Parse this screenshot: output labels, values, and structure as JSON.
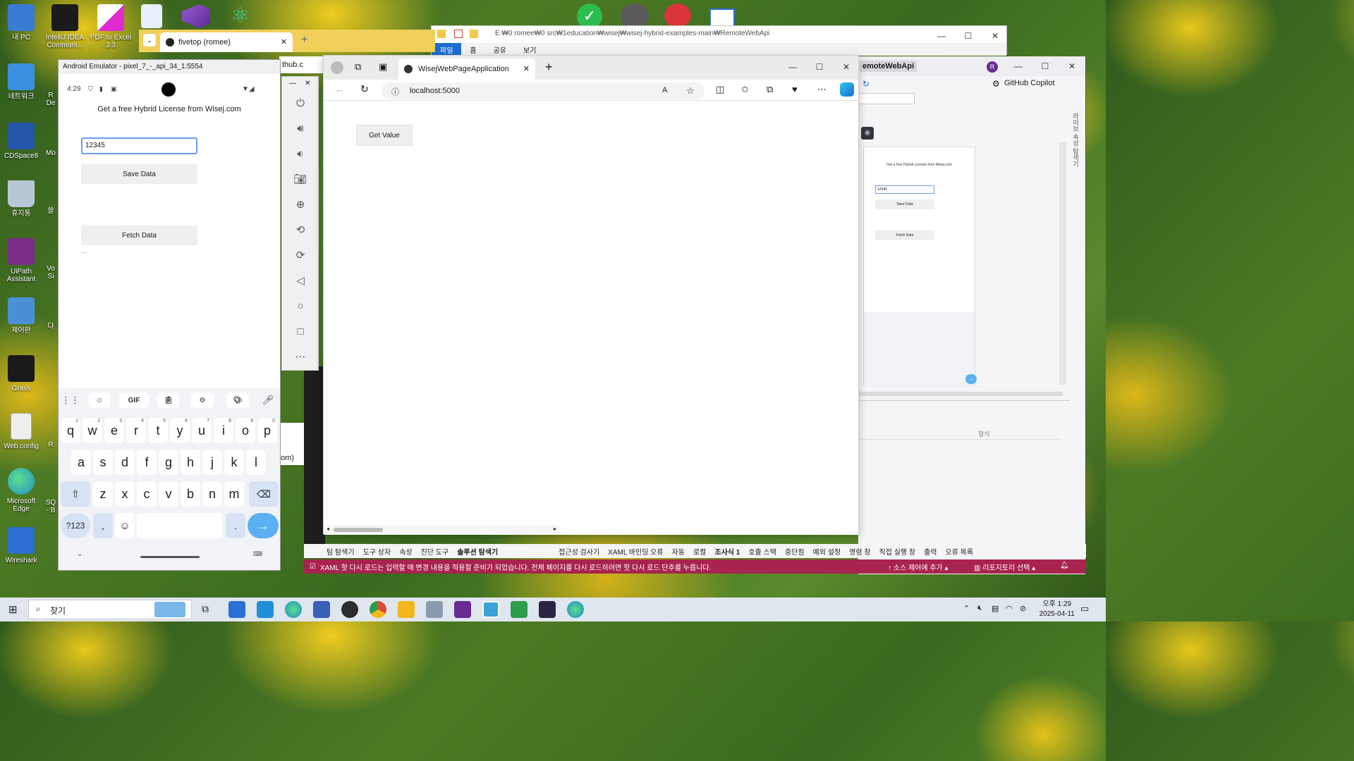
{
  "desktop": {
    "icons": [
      {
        "label": "내 PC",
        "color": "#3a7bd5"
      },
      {
        "label": "IntelliJ IDEA Communi...",
        "color": "#1b1b1b"
      },
      {
        "label": "PDF to Excel 3.3",
        "color": "#f2f2f2"
      },
      {
        "label": "네트워크",
        "color": "#3a8fe0"
      },
      {
        "label": "CDSpace8",
        "color": "#2457a8"
      },
      {
        "label": "휴지통",
        "color": "#b7c7d6"
      },
      {
        "label": "UiPath Assistant",
        "color": "#7b2d87"
      },
      {
        "label": "제어판",
        "color": "#4a90d9"
      },
      {
        "label": "Grass",
        "color": "#1a1a1a"
      },
      {
        "label": "Web.config",
        "color": "#eeeeee"
      },
      {
        "label": "Microsoft Edge",
        "color": "#1e90c8"
      },
      {
        "label": "Wireshark",
        "color": "#2d6fd1"
      }
    ],
    "partial_labels": [
      "R De",
      "Mo",
      "쓸",
      "Vo Si",
      "다",
      "R",
      "SQ - B"
    ]
  },
  "explorer": {
    "path": "E:₩0 romee₩0 src₩1education₩wisej₩wisej-hybrid-examples-main₩RemoteWebApi",
    "tabs": [
      "파일",
      "홈",
      "공유",
      "보기"
    ]
  },
  "chrome": {
    "tab_title": "fivetop (romee)",
    "behind_tab_text": "thub.c"
  },
  "android_emulator": {
    "window_title": "Android Emulator - pixel_7_-_api_34_1:5554",
    "time": "4:29",
    "headline": "Get a free Hybrid License from Wisej.com",
    "input_value": "12345",
    "save_button": "Save Data",
    "fetch_button": "Fetch Data",
    "result_text": "...",
    "keyboard": {
      "toolbar_gif": "GIF",
      "row1": [
        "q",
        "w",
        "e",
        "r",
        "t",
        "y",
        "u",
        "i",
        "o",
        "p"
      ],
      "row1_hints": [
        "1",
        "2",
        "3",
        "4",
        "5",
        "6",
        "7",
        "8",
        "9",
        "0"
      ],
      "row2": [
        "a",
        "s",
        "d",
        "f",
        "g",
        "h",
        "j",
        "k",
        "l"
      ],
      "row3": [
        "z",
        "x",
        "c",
        "v",
        "b",
        "n",
        "m"
      ],
      "symbols_key": "?123",
      "comma_key": ",",
      "period_key": "."
    }
  },
  "edge": {
    "tab_title": "WisejWebPageApplication",
    "url": "localhost:5000",
    "page_button": "Get Value"
  },
  "visual_studio": {
    "title_fragment": "emoteWebApi",
    "avatar_letter": "R",
    "copilot_label": "GitHub Copilot",
    "preview": {
      "headline": "Get a free Hybrid License from Wisej.com",
      "input_value": "12345",
      "save_button": "Save Data",
      "fetch_button": "Fetch Data"
    },
    "output_column_header": "형식",
    "side_tab": "라이브 속성 탐색기",
    "bottom_tabs": [
      "팀 탐색기",
      "도구 상자",
      "속성",
      "진단 도구",
      "솔루션 탐색기",
      "접근성 검사기",
      "XAML 바인딩 오류",
      "자동",
      "로컬",
      "조사식 1",
      "호출 스택",
      "중단점",
      "예외 설정",
      "명령 창",
      "직접 실행 창",
      "출력",
      "오류 목록"
    ],
    "status_message": "XAML 핫 다시 로드는 입력할 때 변경 내용을 적용할 준비가 되었습니다. 전체 페이지를 다시 로드하려면 핫 다시 로드 단추를 누릅니다.",
    "source_control": "소스 제어에 추가",
    "repository": "리포지토리 선택",
    "behind_text": "om)"
  },
  "taskbar": {
    "search_placeholder": "찾기",
    "time": "오후 1:29",
    "date": "2025-04-11",
    "apps": [
      "#2a6fd6",
      "#1f8fd8",
      "#3a5fb8",
      "#2c2c2c",
      "#dd4b39",
      "#f2b71c",
      "#8a9bb0",
      "#6a2c91",
      "#3aa3d8",
      "#2e9d4a",
      "#2b2245",
      "#1e88c8"
    ]
  }
}
